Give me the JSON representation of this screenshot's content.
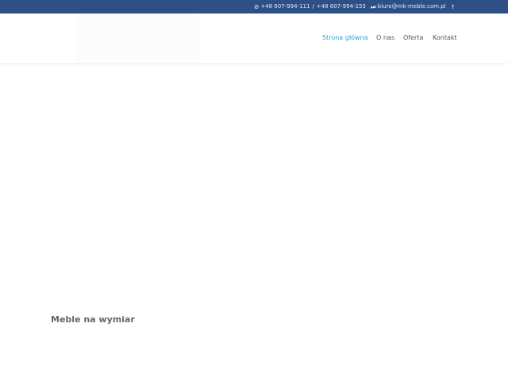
{
  "topbar": {
    "phone_icon": "phone-slash-icon",
    "phone1": "+48 607-994-111",
    "separator": "/",
    "phone2": "+48 607-994-155",
    "email_icon": "fast-forward-icon",
    "email": "biuro@mk-meble.com.pl",
    "up_icon": "arrow-up-icon"
  },
  "nav": {
    "items": [
      {
        "label": "Strona główna",
        "active": true
      },
      {
        "label": "O nas"
      },
      {
        "label": "Oferta"
      },
      {
        "label": "Kontakt"
      }
    ]
  },
  "main": {
    "title": "Meble na wymiar"
  },
  "colors": {
    "topbar_bg": "#2d4f86",
    "accent": "#2aa5d6",
    "nav_text": "#555555",
    "title_text": "#666666"
  }
}
